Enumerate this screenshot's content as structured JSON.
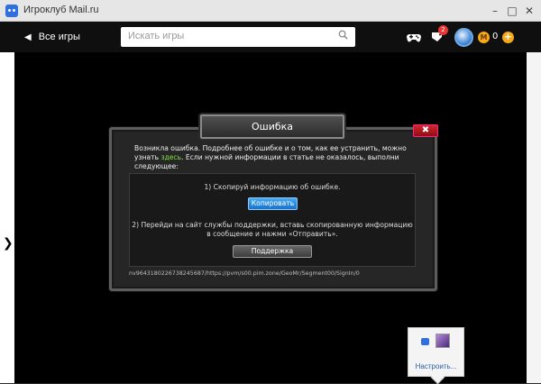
{
  "window": {
    "title": "Игроклуб Mail.ru",
    "minimize": "–",
    "maximize": "□",
    "close": "✕"
  },
  "toolbar": {
    "back_label": "Все игры",
    "search_placeholder": "Искать игры",
    "notifications_count": "2",
    "coins": "0",
    "coin_symbol": "М",
    "add_label": "+"
  },
  "dialog": {
    "title": "Ошибка",
    "intro_before": "Возникла ошибка. Подробнее об ошибке и о том, как ее устранить, можно узнать ",
    "intro_link": "здесь",
    "intro_after": ". Если нужной информации в статье не оказалось, выполни следующее:",
    "step1": "1) Скопируй информацию об ошибке.",
    "copy_button": "Копировать",
    "step2": "2) Перейди на сайт службы поддержки, вставь скопированную информацию в сообщение и нажми «Отправить».",
    "support_button": "Поддержка",
    "error_info": "nv9643180226738245687/https://pvm/s00.pim.zone/GeoMr/Segment00/SignIn/0"
  },
  "tray": {
    "configure": "Настроить..."
  },
  "colors": {
    "accent_link": "#7de23c",
    "copy_button": "#1f84dc",
    "close_button": "#c41e22",
    "coin": "#f6a91a"
  }
}
